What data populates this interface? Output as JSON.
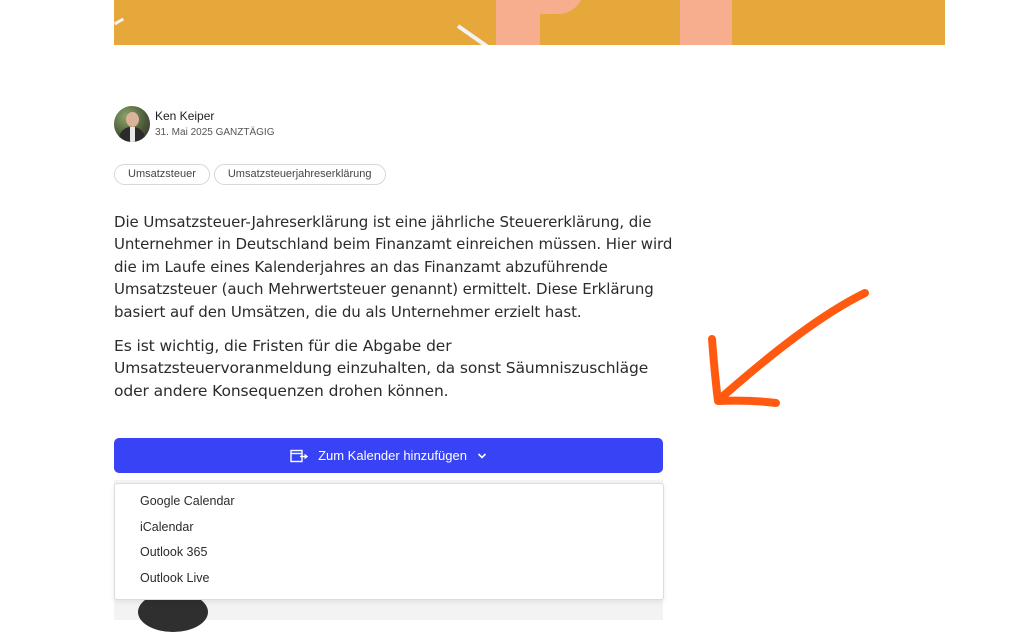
{
  "author": {
    "name": "Ken Keiper",
    "date": "31. Mai 2025 GANZTÄGIG"
  },
  "tags": [
    "Umsatzsteuer",
    "Umsatzsteuerjahreserklärung"
  ],
  "content": {
    "paragraphs": [
      "Die Umsatzsteuer-Jahreserklärung ist eine jährliche Steuererklärung, die Unternehmer in Deutschland beim Finanzamt einreichen müssen. Hier wird die im Laufe eines Kalenderjahres an das Finanzamt abzuführende Umsatzsteuer (auch Mehrwertsteuer genannt) ermittelt. Diese Erklärung basiert auf den Umsätzen, die du als Unternehmer erzielt hast.",
      "Es ist wichtig, die Fristen für die Abgabe der Umsatzsteuervoranmeldung einzuhalten, da sonst Säumniszuschläge oder andere Konsequenzen drohen können."
    ]
  },
  "calendar": {
    "button_label": "Zum Kalender hinzufügen",
    "options": [
      "Google Calendar",
      "iCalendar",
      "Outlook 365",
      "Outlook Live"
    ]
  },
  "colors": {
    "hero": "#e6a83b",
    "button": "#3843f5",
    "annotation_arrow": "#ff5a10"
  },
  "icons": {
    "calendar_add": "calendar-add-icon",
    "chevron": "chevron-down-icon",
    "annotation": "annotation-arrow-icon"
  }
}
